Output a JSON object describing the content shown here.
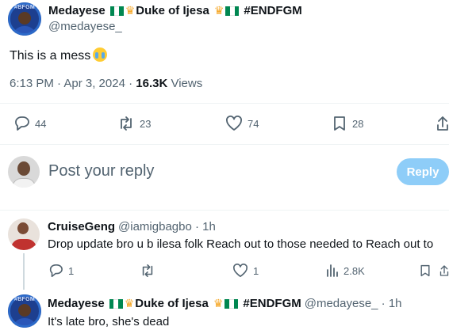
{
  "main_tweet": {
    "display_name": "Medayese",
    "title_text": "Duke of Ijesa",
    "hashtag": "#ENDFGM",
    "handle": "@medayese_",
    "avatar_text": "#BFGM",
    "body": "This is a mess",
    "time": "6:13 PM · Apr 3, 2024 · ",
    "views_count": "16.3K",
    "views_label": " Views",
    "replies": "44",
    "retweets": "23",
    "likes": "74",
    "bookmarks": "28"
  },
  "composer": {
    "placeholder": "Post your reply",
    "button": "Reply"
  },
  "replies": [
    {
      "display_name": "CruiseGeng",
      "handle": "@iamigbagbo · 1h",
      "body": "Drop update bro u b ilesa folk Reach out to those needed to Reach out to",
      "replies": "1",
      "likes": "1",
      "views": "2.8K"
    },
    {
      "display_name": "Medayese",
      "title_text": "Duke of Ijesa",
      "hashtag": "#ENDFGM",
      "handle": "@medayese_ · 1h",
      "avatar_text": "#BFGM",
      "body": "It's late bro, she's dead"
    }
  ],
  "colors": {
    "muted": "#536471",
    "text": "#0f1419",
    "reply_button_bg": "#8ecdf8",
    "divider": "#eff3f4",
    "flag_green": "#008751",
    "crown": "#f5a623"
  },
  "icons": [
    "reply-icon",
    "retweet-icon",
    "like-icon",
    "bookmark-icon",
    "share-icon",
    "views-icon",
    "crown-icon",
    "nigeria-flag-icon",
    "loudly-crying-face-emoji"
  ]
}
